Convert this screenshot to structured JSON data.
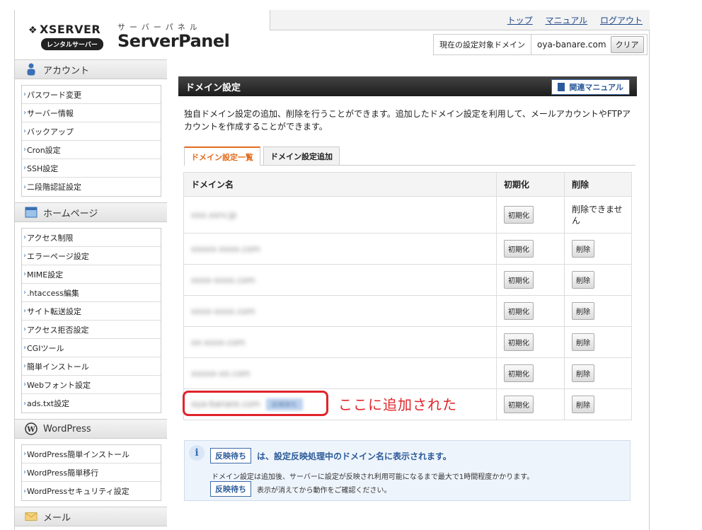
{
  "brand": {
    "logo": "XSERVER",
    "badge": "レンタルサーバー",
    "subtitle": "サーバーパネル",
    "title": "ServerPanel"
  },
  "toplinks": [
    "トップ",
    "マニュアル",
    "ログアウト"
  ],
  "domain_bar": {
    "label": "現在の設定対象ドメイン",
    "value": "oya-banare.com",
    "clear": "クリア"
  },
  "sidebar": {
    "sections": [
      {
        "title": "アカウント",
        "icon": "user-icon",
        "items": [
          "パスワード変更",
          "サーバー情報",
          "バックアップ",
          "Cron設定",
          "SSH設定",
          "二段階認証設定"
        ]
      },
      {
        "title": "ホームページ",
        "icon": "homepage-icon",
        "items": [
          "アクセス制限",
          "エラーページ設定",
          "MIME設定",
          ".htaccess編集",
          "サイト転送設定",
          "アクセス拒否設定",
          "CGIツール",
          "簡単インストール",
          "Webフォント設定",
          "ads.txt設定"
        ]
      },
      {
        "title": "WordPress",
        "icon": "wordpress-icon",
        "items": [
          "WordPress簡単インストール",
          "WordPress簡単移行",
          "WordPressセキュリティ設定"
        ]
      },
      {
        "title": "メール",
        "icon": "mail-icon",
        "items": []
      }
    ]
  },
  "main": {
    "title": "ドメイン設定",
    "manual_btn": "関連マニュアル",
    "desc": "独自ドメイン設定の追加、削除を行うことができます。追加したドメイン設定を利用して、メールアカウントやFTPアカウントを作成することができます。",
    "tabs": [
      "ドメイン設定一覧",
      "ドメイン設定追加"
    ],
    "table": {
      "headers": [
        "ドメイン名",
        "初期化",
        "削除"
      ],
      "init_label": "初期化",
      "delete_label": "削除",
      "cant_delete": "削除できません",
      "rows": [
        "xxx.xsrv.jp",
        "xxxxx-xxxx.com",
        "xxxx-xxxx.com",
        "xxxx-xxxx.com",
        "xx-xxxx.com",
        "xxxxx-xx.com",
        "oya-banare.com"
      ],
      "pending_tag": "反映待ち"
    },
    "annotation": "ここに追加された",
    "info": {
      "pending": "反映待ち",
      "head": "は、設定反映処理中のドメイン名に表示されます。",
      "line1": "ドメイン設定は追加後、サーバーに設定が反映され利用可能になるまで最大で1時間程度かかります。",
      "line2": "表示が消えてから動作をご確認ください。"
    }
  }
}
